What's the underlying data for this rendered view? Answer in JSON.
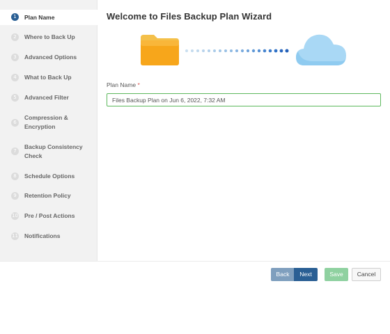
{
  "wizard": {
    "title": "Welcome to Files Backup Plan Wizard"
  },
  "sidebar": {
    "active_index": 0,
    "steps": [
      {
        "num": "1",
        "label": "Plan Name"
      },
      {
        "num": "2",
        "label": "Where to Back Up"
      },
      {
        "num": "3",
        "label": "Advanced Options"
      },
      {
        "num": "4",
        "label": "What to Back Up"
      },
      {
        "num": "5",
        "label": "Advanced Filter"
      },
      {
        "num": "6",
        "label": "Compression & Encryption"
      },
      {
        "num": "7",
        "label": "Backup Consistency Check"
      },
      {
        "num": "8",
        "label": "Schedule Options"
      },
      {
        "num": "9",
        "label": "Retention Policy"
      },
      {
        "num": "10",
        "label": "Pre / Post Actions"
      },
      {
        "num": "11",
        "label": "Notifications"
      }
    ]
  },
  "illustration": {
    "left_icon": "folder-icon",
    "right_icon": "cloud-icon",
    "folder_color": "#f7a61b",
    "cloud_color": "#a9d8f5"
  },
  "form": {
    "plan_name_label": "Plan Name",
    "required_marker": "*",
    "plan_name_value": "Files Backup Plan on Jun 6, 2022, 7:32 AM"
  },
  "footer": {
    "back_label": "Back",
    "next_label": "Next",
    "save_label": "Save",
    "cancel_label": "Cancel"
  },
  "colors": {
    "accent": "#2a5f94",
    "valid_border": "#5cb85c",
    "save": "#8fd1a0"
  }
}
